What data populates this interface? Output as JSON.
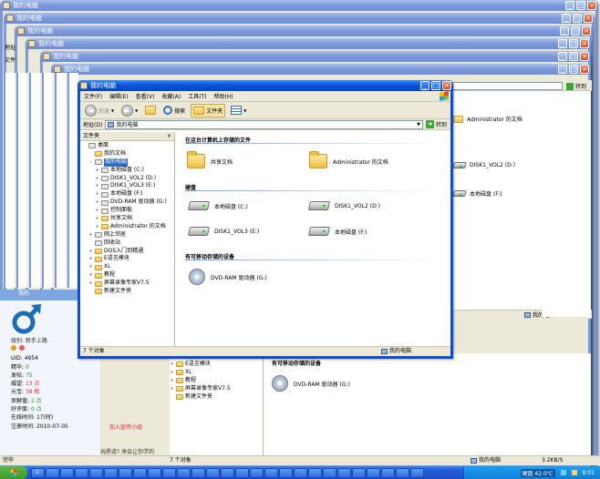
{
  "window_title": "我的电脑",
  "menu": [
    "文件(F)",
    "编辑(E)",
    "查看(V)",
    "收藏(A)",
    "工具(T)",
    "帮助(H)"
  ],
  "toolbar": {
    "back": "后退",
    "search": "搜索",
    "folders": "文件夹"
  },
  "address": {
    "label": "地址(D)",
    "value": "我的电脑",
    "go": "转到"
  },
  "folders_pane": {
    "title": "文件夹",
    "close": "×"
  },
  "tree": [
    {
      "label": "桌面",
      "level": 0,
      "toggle": "",
      "folder": false
    },
    {
      "label": "我的文档",
      "level": 1,
      "toggle": "",
      "folder": true
    },
    {
      "label": "我的电脑",
      "level": 1,
      "toggle": "−",
      "folder": false,
      "selected": true
    },
    {
      "label": "本地磁盘 (C:)",
      "level": 2,
      "toggle": "+",
      "folder": false
    },
    {
      "label": "DISK1_VOL2 (D:)",
      "level": 2,
      "toggle": "+",
      "folder": false
    },
    {
      "label": "DISK1_VOL3 (E:)",
      "level": 2,
      "toggle": "+",
      "folder": false
    },
    {
      "label": "本地磁盘 (F:)",
      "level": 2,
      "toggle": "+",
      "folder": false
    },
    {
      "label": "DVD-RAM 驱动器 (G:)",
      "level": 2,
      "toggle": "+",
      "folder": false
    },
    {
      "label": "控制面板",
      "level": 2,
      "toggle": "+",
      "folder": false
    },
    {
      "label": "共享文档",
      "level": 2,
      "toggle": "+",
      "folder": true
    },
    {
      "label": "Administrator 的文档",
      "level": 2,
      "toggle": "+",
      "folder": true
    },
    {
      "label": "网上邻居",
      "level": 1,
      "toggle": "+",
      "folder": false
    },
    {
      "label": "回收站",
      "level": 1,
      "toggle": "",
      "folder": false
    },
    {
      "label": "DOS入门到精通",
      "level": 1,
      "toggle": "+",
      "folder": true
    },
    {
      "label": "E语言模块",
      "level": 1,
      "toggle": "+",
      "folder": true
    },
    {
      "label": "XL",
      "level": 1,
      "toggle": "+",
      "folder": true
    },
    {
      "label": "教程",
      "level": 1,
      "toggle": "+",
      "folder": true
    },
    {
      "label": "屏幕录像专家V7.5",
      "level": 1,
      "toggle": "+",
      "folder": true
    },
    {
      "label": "新建文件夹",
      "level": 1,
      "toggle": "",
      "folder": true
    }
  ],
  "sections": {
    "stored": "在这台计算机上存储的文件",
    "hdd": "硬盘",
    "removable": "有可移动存储的设备"
  },
  "stored_items": [
    "共享文档",
    "Administrator 的文档"
  ],
  "drives": [
    "本地磁盘 (C:)",
    "DISK1_VOL2 (D:)",
    "DISK1_VOL3 (E:)",
    "本地磁盘 (F:)"
  ],
  "removable_items": [
    "DVD-RAM 驱动器 (G:)"
  ],
  "status": {
    "count": "7 个对象",
    "location": "我的电脑"
  },
  "bg_windows": {
    "addr_label": "地址",
    "file_menu": "文件",
    "admin_docs": "Administrator 的文档",
    "disk_d": "DISK1_VOL2 (D:)",
    "disk_f": "本地磁盘 (F:)",
    "go": "转到",
    "count": "7 个对象",
    "location": "我的电脑",
    "removable": "有可移动存储的设备",
    "dvd": "DVD-RAM 驱动器 (G:)",
    "tree": [
      "E语言模块",
      "XL",
      "教程",
      "屏幕录像专家V7.5",
      "新建文件夹"
    ]
  },
  "forum": {
    "title": "我的",
    "level": "级别: 新手上路",
    "stats": [
      {
        "label": "UID:",
        "value": "4954"
      },
      {
        "label": "精华:",
        "value": "0"
      },
      {
        "label": "发帖:",
        "value": "75"
      },
      {
        "label": "威望:",
        "value": "13 点"
      },
      {
        "label": "元宝:",
        "value": "38 枚"
      },
      {
        "label": "贡献值:",
        "value": "2 点"
      },
      {
        "label": "好评度:",
        "value": "0 点"
      },
      {
        "label": "在线时间:",
        "value": "17(时)"
      },
      {
        "label": "注册时间:",
        "value": "2010-07-05"
      }
    ],
    "promo": "加入宣传小组",
    "tip": "玩质道? 来会让你学的"
  },
  "browser_status": "完毕",
  "bottom_status": {
    "count": "7 个对象",
    "location": "我的电脑",
    "speed": "3.2KB/S",
    "speed2": "3.2KB/S"
  },
  "taskbar": {
    "tasks": [
      "2.",
      "",
      "",
      "",
      "",
      "",
      "",
      "",
      "",
      "",
      "",
      "",
      "",
      "",
      "",
      "",
      "",
      "",
      "",
      "",
      "",
      "",
      "",
      "",
      "",
      "",
      ""
    ],
    "tray_text": "硬盘 42.0℃",
    "clock": "8:01"
  }
}
